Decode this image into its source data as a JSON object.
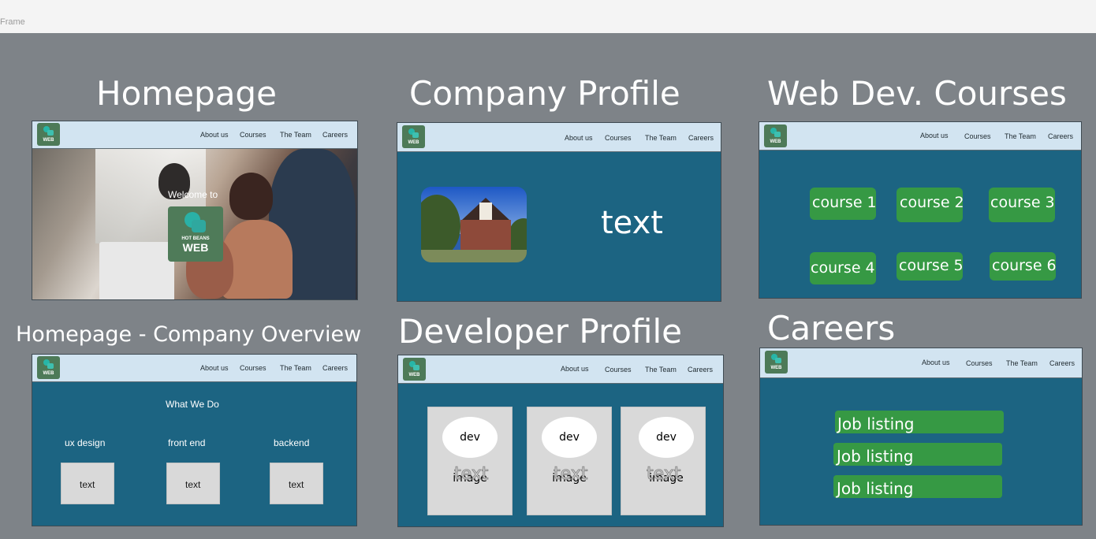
{
  "frame_label": "Frame",
  "titles": {
    "homepage": "Homepage",
    "company_profile": "Company Profile",
    "web_dev_courses": "Web Dev. Courses",
    "overview": "Homepage - Company Overview",
    "developer_profile": "Developer Profile",
    "careers": "Careers"
  },
  "nav": {
    "about": "About us",
    "courses": "Courses",
    "team": "The Team",
    "careers": "Careers",
    "logo_text": "WEB"
  },
  "homepage": {
    "welcome": "Welcome to",
    "logo_small": "HOT BEANS",
    "logo_big": "WEB"
  },
  "company_profile": {
    "text": "text"
  },
  "courses": [
    "course 1",
    "course 2",
    "course 3",
    "course 4",
    "course 5",
    "course 6"
  ],
  "overview": {
    "heading": "What We Do",
    "columns": [
      {
        "label": "ux design",
        "box": "text"
      },
      {
        "label": "front end",
        "box": "text"
      },
      {
        "label": "backend",
        "box": "text"
      }
    ]
  },
  "developers": [
    {
      "image": "dev image",
      "text": "text"
    },
    {
      "image": "dev image",
      "text": "text"
    },
    {
      "image": "dev image",
      "text": "text"
    }
  ],
  "jobs": [
    "Job listing",
    "Job listing",
    "Job listing"
  ],
  "colors": {
    "canvas": "#7e8388",
    "card_blue": "#1c6482",
    "nav_bg": "#d2e4f1",
    "button_green": "#369944",
    "logo_green": "#4d7a58"
  },
  "icons": [
    "hot-beans-logo-icon"
  ]
}
